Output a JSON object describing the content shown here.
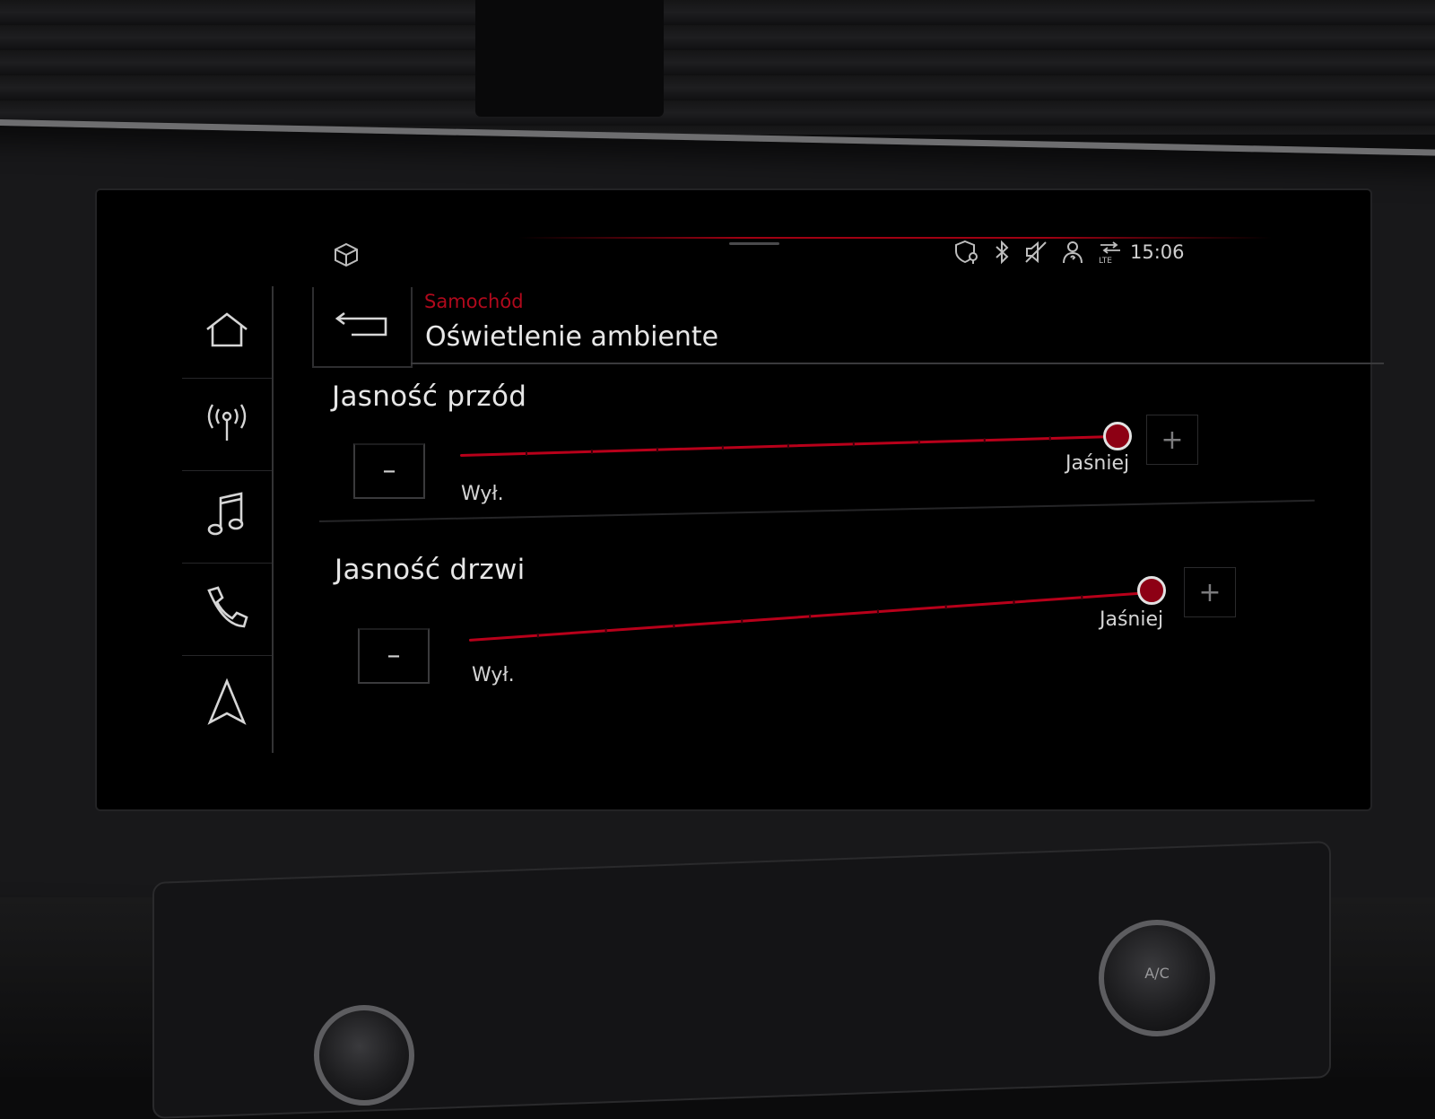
{
  "status_bar": {
    "time": "15:06",
    "icons": [
      "cube-icon",
      "location-shield-icon",
      "bluetooth-icon",
      "mute-icon",
      "user-profile-icon",
      "lte-signal-icon"
    ]
  },
  "sidebar": {
    "items": [
      {
        "icon": "home-icon"
      },
      {
        "icon": "radio-icon"
      },
      {
        "icon": "music-note-icon"
      },
      {
        "icon": "phone-icon"
      },
      {
        "icon": "navigation-icon"
      }
    ]
  },
  "header": {
    "breadcrumb": "Samochód",
    "title": "Oświetlenie ambiente"
  },
  "sliders": [
    {
      "title": "Jasność przód",
      "min_label": "Wył.",
      "max_label": "Jaśniej",
      "decrease_label": "–",
      "increase_label": "+",
      "value_fraction": 1.0
    },
    {
      "title": "Jasność drzwi",
      "min_label": "Wył.",
      "max_label": "Jaśniej",
      "decrease_label": "–",
      "increase_label": "+",
      "value_fraction": 1.0
    }
  ],
  "console": {
    "knob_label": "A/C"
  },
  "colors": {
    "accent": "#b8001a",
    "breadcrumb": "#b0091c",
    "text": "#e6e6e6"
  }
}
